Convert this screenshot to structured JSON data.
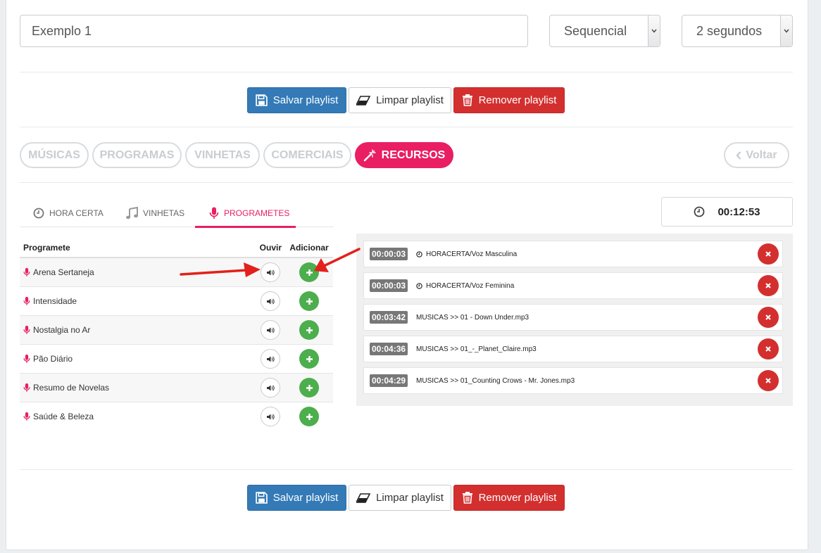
{
  "form": {
    "name_value": "Exemplo 1",
    "mode_value": "Sequencial",
    "interval_value": "2 segundos"
  },
  "actions": {
    "save_label": "Salvar playlist",
    "clear_label": "Limpar playlist",
    "remove_label": "Remover playlist"
  },
  "categories": {
    "items": [
      "MÚSICAS",
      "PROGRAMAS",
      "VINHETAS",
      "COMERCIAIS",
      "RECURSOS"
    ],
    "active": "RECURSOS",
    "back_label": "Voltar"
  },
  "subtabs": {
    "items": [
      "HORA CERTA",
      "VINHETAS",
      "PROGRAMETES"
    ],
    "active": "PROGRAMETES"
  },
  "table": {
    "headers": [
      "Programete",
      "Ouvir",
      "Adicionar"
    ],
    "rows": [
      "Arena Sertaneja",
      "Intensidade",
      "Nostalgia no Ar",
      "Pão Diário",
      "Resumo de Novelas",
      "Saúde & Beleza"
    ]
  },
  "playlist": {
    "total_time": "00:12:53",
    "items": [
      {
        "time": "00:00:03",
        "name": "HORACERTA/Voz Masculina",
        "clock": true
      },
      {
        "time": "00:00:03",
        "name": "HORACERTA/Voz Feminina",
        "clock": true
      },
      {
        "time": "00:03:42",
        "name": "MUSICAS >> 01 - Down Under.mp3",
        "clock": false
      },
      {
        "time": "00:04:36",
        "name": "MUSICAS >> 01_-_Planet_Claire.mp3",
        "clock": false
      },
      {
        "time": "00:04:29",
        "name": "MUSICAS >> 01_Counting Crows - Mr. Jones.mp3",
        "clock": false
      }
    ]
  },
  "colors": {
    "accent": "#e91e63",
    "primary": "#337ab7",
    "danger": "#d32f2f",
    "success": "#4cae4c",
    "annotation_arrow": "#e3201b"
  }
}
